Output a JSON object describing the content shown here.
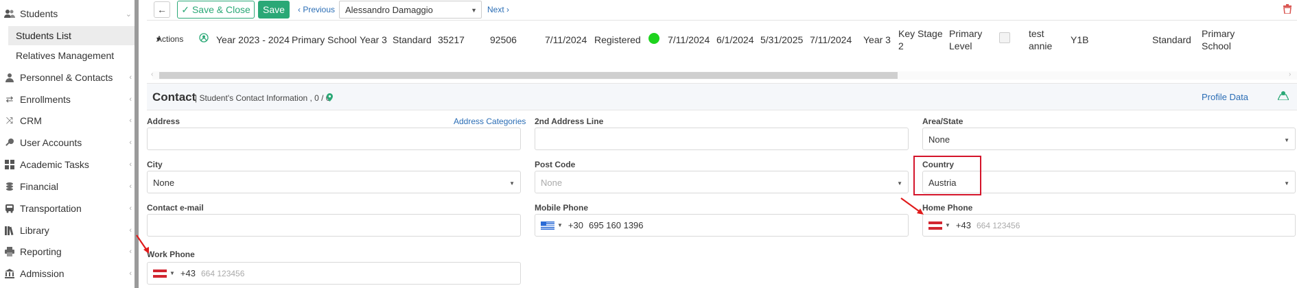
{
  "sidebar": {
    "students": "Students",
    "students_list": "Students List",
    "relatives": "Relatives Management",
    "personnel": "Personnel & Contacts",
    "enrollments": "Enrollments",
    "crm": "CRM",
    "user_accounts": "User Accounts",
    "academic_tasks": "Academic Tasks",
    "financial": "Financial",
    "transportation": "Transportation",
    "library": "Library",
    "reporting": "Reporting",
    "admission": "Admission"
  },
  "toolbar": {
    "back_icon": "←",
    "save_close": "Save & Close",
    "save": "Save",
    "previous": "Previous",
    "student": "Alessandro Damaggio",
    "next": "Next"
  },
  "info": {
    "actions": "Actions",
    "year": "Year 2023 - 2024",
    "school": "Primary School",
    "grade": "Year 3",
    "type": "Standard",
    "code1": "35217",
    "code2": "92506",
    "date1": "7/11/2024",
    "status": "Registered",
    "date2": "7/11/2024",
    "date3": "6/1/2024",
    "date4": "5/31/2025",
    "date5": "7/11/2024",
    "grade2": "Year 3",
    "key_stage_1": "Key Stage",
    "key_stage_2": "2",
    "level_1": "Primary",
    "level_2": "Level",
    "test_1": "test",
    "test_2": "annie",
    "class": "Y1B",
    "type2": "Standard",
    "school2_1": "Primary",
    "school2_2": "School"
  },
  "contact": {
    "title": "Contact",
    "subtitle": "| Student's Contact Information , 0 / 0",
    "profile_data": "Profile Data",
    "address_label": "Address",
    "address_categories": "Address Categories",
    "address2_label": "2nd Address Line",
    "area_label": "Area/State",
    "area_value": "None",
    "city_label": "City",
    "city_value": "None",
    "postcode_label": "Post Code",
    "postcode_value": "None",
    "country_label": "Country",
    "country_value": "Austria",
    "email_label": "Contact e-mail",
    "mobile_label": "Mobile Phone",
    "mobile_code": "+30",
    "mobile_number": "695 160 1396",
    "home_label": "Home Phone",
    "home_code": "+43",
    "home_placeholder": "664 123456",
    "work_label": "Work Phone",
    "work_code": "+43",
    "work_placeholder": "664 123456"
  },
  "colors": {
    "accent": "#2aa876",
    "link": "#2a6db5",
    "highlight": "#d4142a",
    "status_green": "#1ed31e"
  }
}
